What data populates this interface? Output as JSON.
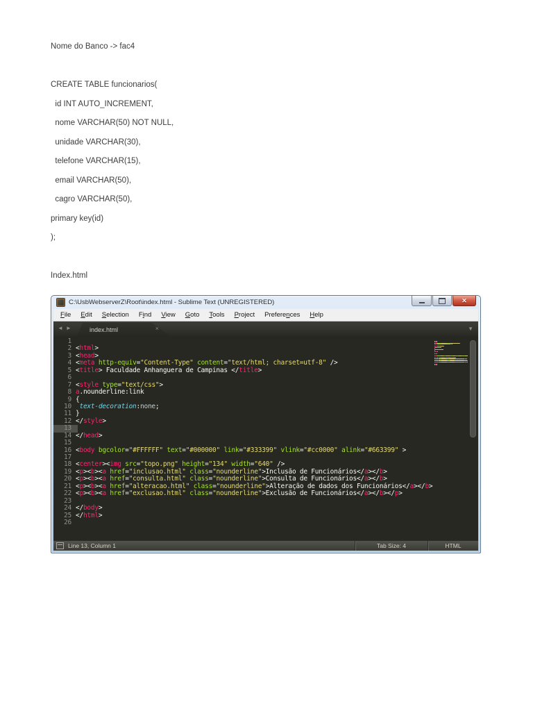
{
  "document": {
    "lines": [
      "Nome do Banco -> fac4",
      "",
      "CREATE TABLE funcionarios(",
      "  id INT AUTO_INCREMENT,",
      "  nome VARCHAR(50) NOT NULL,",
      "  unidade VARCHAR(30),",
      "  telefone VARCHAR(15),",
      "  email VARCHAR(50),",
      "  cagro VARCHAR(50),",
      "primary key(id)",
      ");",
      "",
      "Index.html"
    ]
  },
  "window": {
    "title": "C:\\UsbWebserverZ\\Root\\index.html - Sublime Text (UNREGISTERED)",
    "controls": {
      "close_glyph": "✕"
    },
    "menu_items": [
      {
        "label": "File",
        "underline": 0
      },
      {
        "label": "Edit",
        "underline": 0
      },
      {
        "label": "Selection",
        "underline": 0
      },
      {
        "label": "Find",
        "underline": 1
      },
      {
        "label": "View",
        "underline": 0
      },
      {
        "label": "Goto",
        "underline": 0
      },
      {
        "label": "Tools",
        "underline": 0
      },
      {
        "label": "Project",
        "underline": 0
      },
      {
        "label": "Preferences",
        "underline": 7
      },
      {
        "label": "Help",
        "underline": 0
      }
    ],
    "nav": {
      "back": "◄",
      "forward": "►",
      "overflow": "▼"
    },
    "tab": {
      "label": "index.html",
      "close": "×"
    },
    "editor": {
      "current_line": 13,
      "line_count": 26,
      "colors": {
        "background": "#272822",
        "gutter": "#8f908a",
        "tag": "#f92672",
        "attribute": "#a6e22e",
        "string": "#e6db74",
        "plain_text": "#f8f8f2",
        "css_property": "#66d9ef",
        "css_value": "#c5cece"
      },
      "lines": [
        [],
        [
          [
            "<",
            "p"
          ],
          [
            "html",
            "t"
          ],
          [
            ">",
            "p"
          ]
        ],
        [
          [
            "<",
            "p"
          ],
          [
            "head",
            "t"
          ],
          [
            ">",
            "p"
          ]
        ],
        [
          [
            "<",
            "p"
          ],
          [
            "meta",
            "t"
          ],
          [
            " ",
            "p"
          ],
          [
            "http-equiv",
            "a"
          ],
          [
            "=",
            "p"
          ],
          [
            "\"Content-Type\"",
            "s"
          ],
          [
            " ",
            "p"
          ],
          [
            "content",
            "a"
          ],
          [
            "=",
            "p"
          ],
          [
            "\"text/html; charset=utf-8\"",
            "s"
          ],
          [
            " />",
            "p"
          ]
        ],
        [
          [
            "<",
            "p"
          ],
          [
            "title",
            "t"
          ],
          [
            ">",
            "p"
          ],
          [
            " Faculdade Anhanguera de Campinas ",
            "x"
          ],
          [
            "</",
            "p"
          ],
          [
            "title",
            "t"
          ],
          [
            ">",
            "p"
          ]
        ],
        [],
        [
          [
            "<",
            "p"
          ],
          [
            "style",
            "t"
          ],
          [
            " ",
            "p"
          ],
          [
            "type",
            "a"
          ],
          [
            "=",
            "p"
          ],
          [
            "\"text/css\"",
            "s"
          ],
          [
            ">",
            "p"
          ]
        ],
        [
          [
            "a",
            "t"
          ],
          [
            ".nounderline:link",
            "x"
          ]
        ],
        [
          [
            "{",
            "p"
          ]
        ],
        [
          [
            " ",
            "p"
          ],
          [
            "text-decoration",
            "c"
          ],
          [
            ":",
            "p"
          ],
          [
            "none",
            "v"
          ],
          [
            ";",
            "p"
          ]
        ],
        [
          [
            "}",
            "p"
          ]
        ],
        [
          [
            "</",
            "p"
          ],
          [
            "style",
            "t"
          ],
          [
            ">",
            "p"
          ]
        ],
        [],
        [
          [
            "</",
            "p"
          ],
          [
            "head",
            "t"
          ],
          [
            ">",
            "p"
          ]
        ],
        [],
        [
          [
            "<",
            "p"
          ],
          [
            "body",
            "t"
          ],
          [
            " ",
            "p"
          ],
          [
            "bgcolor",
            "a"
          ],
          [
            "=",
            "p"
          ],
          [
            "\"#FFFFFF\"",
            "s"
          ],
          [
            " ",
            "p"
          ],
          [
            "text",
            "a"
          ],
          [
            "=",
            "p"
          ],
          [
            "\"#000000\"",
            "s"
          ],
          [
            " ",
            "p"
          ],
          [
            "link",
            "a"
          ],
          [
            "=",
            "p"
          ],
          [
            "\"#333399\"",
            "s"
          ],
          [
            " ",
            "p"
          ],
          [
            "vlink",
            "a"
          ],
          [
            "=",
            "p"
          ],
          [
            "\"#cc0000\"",
            "s"
          ],
          [
            " ",
            "p"
          ],
          [
            "alink",
            "a"
          ],
          [
            "=",
            "p"
          ],
          [
            "\"#663399\"",
            "s"
          ],
          [
            " >",
            "p"
          ]
        ],
        [],
        [
          [
            "<",
            "p"
          ],
          [
            "center",
            "t"
          ],
          [
            "><",
            "p"
          ],
          [
            "img",
            "t"
          ],
          [
            " ",
            "p"
          ],
          [
            "src",
            "a"
          ],
          [
            "=",
            "p"
          ],
          [
            "\"topo.png\"",
            "s"
          ],
          [
            " ",
            "p"
          ],
          [
            "height",
            "a"
          ],
          [
            "=",
            "p"
          ],
          [
            "\"134\"",
            "s"
          ],
          [
            " ",
            "p"
          ],
          [
            "width",
            "a"
          ],
          [
            "=",
            "p"
          ],
          [
            "\"640\"",
            "s"
          ],
          [
            " />",
            "p"
          ]
        ],
        [
          [
            "<",
            "p"
          ],
          [
            "p",
            "t"
          ],
          [
            "><",
            "p"
          ],
          [
            "b",
            "t"
          ],
          [
            "><",
            "p"
          ],
          [
            "a",
            "t"
          ],
          [
            " ",
            "p"
          ],
          [
            "href",
            "a"
          ],
          [
            "=",
            "p"
          ],
          [
            "\"inclusao.html\"",
            "s"
          ],
          [
            " ",
            "p"
          ],
          [
            "class",
            "a"
          ],
          [
            "=",
            "p"
          ],
          [
            "\"nounderline\"",
            "s"
          ],
          [
            ">",
            "p"
          ],
          [
            "Inclusão de Funcionários",
            "x"
          ],
          [
            "</",
            "p"
          ],
          [
            "a",
            "t"
          ],
          [
            "></",
            "p"
          ],
          [
            "b",
            "t"
          ],
          [
            ">",
            "p"
          ]
        ],
        [
          [
            "<",
            "p"
          ],
          [
            "p",
            "t"
          ],
          [
            "><",
            "p"
          ],
          [
            "b",
            "t"
          ],
          [
            "><",
            "p"
          ],
          [
            "a",
            "t"
          ],
          [
            " ",
            "p"
          ],
          [
            "href",
            "a"
          ],
          [
            "=",
            "p"
          ],
          [
            "\"consulta.html\"",
            "s"
          ],
          [
            " ",
            "p"
          ],
          [
            "class",
            "a"
          ],
          [
            "=",
            "p"
          ],
          [
            "\"nounderline\"",
            "s"
          ],
          [
            ">",
            "p"
          ],
          [
            "Consulta de Funcionários",
            "x"
          ],
          [
            "</",
            "p"
          ],
          [
            "a",
            "t"
          ],
          [
            "></",
            "p"
          ],
          [
            "b",
            "t"
          ],
          [
            ">",
            "p"
          ]
        ],
        [
          [
            "<",
            "p"
          ],
          [
            "p",
            "t"
          ],
          [
            "><",
            "p"
          ],
          [
            "b",
            "t"
          ],
          [
            "><",
            "p"
          ],
          [
            "a",
            "t"
          ],
          [
            " ",
            "p"
          ],
          [
            "href",
            "a"
          ],
          [
            "=",
            "p"
          ],
          [
            "\"alteracao.html\"",
            "s"
          ],
          [
            " ",
            "p"
          ],
          [
            "class",
            "a"
          ],
          [
            "=",
            "p"
          ],
          [
            "\"nounderline\"",
            "s"
          ],
          [
            ">",
            "p"
          ],
          [
            "Alteração de dados dos Funcionários",
            "x"
          ],
          [
            "</",
            "p"
          ],
          [
            "a",
            "t"
          ],
          [
            "></",
            "p"
          ],
          [
            "b",
            "t"
          ],
          [
            ">",
            "p"
          ]
        ],
        [
          [
            "<",
            "p"
          ],
          [
            "p",
            "t"
          ],
          [
            "><",
            "p"
          ],
          [
            "b",
            "t"
          ],
          [
            "><",
            "p"
          ],
          [
            "a",
            "t"
          ],
          [
            " ",
            "p"
          ],
          [
            "href",
            "a"
          ],
          [
            "=",
            "p"
          ],
          [
            "\"exclusao.html\"",
            "s"
          ],
          [
            " ",
            "p"
          ],
          [
            "class",
            "a"
          ],
          [
            "=",
            "p"
          ],
          [
            "\"nounderline\"",
            "s"
          ],
          [
            ">",
            "p"
          ],
          [
            "Exclusão de Funcionários",
            "x"
          ],
          [
            "</",
            "p"
          ],
          [
            "a",
            "t"
          ],
          [
            "></",
            "p"
          ],
          [
            "b",
            "t"
          ],
          [
            "></",
            "p"
          ],
          [
            "p",
            "t"
          ],
          [
            ">",
            "p"
          ]
        ],
        [],
        [
          [
            "</",
            "p"
          ],
          [
            "body",
            "t"
          ],
          [
            ">",
            "p"
          ]
        ],
        [
          [
            "</",
            "p"
          ],
          [
            "html",
            "t"
          ],
          [
            ">",
            "p"
          ]
        ],
        []
      ]
    },
    "status": {
      "position": "Line 13, Column 1",
      "tab_size": "Tab Size: 4",
      "syntax": "HTML"
    }
  }
}
